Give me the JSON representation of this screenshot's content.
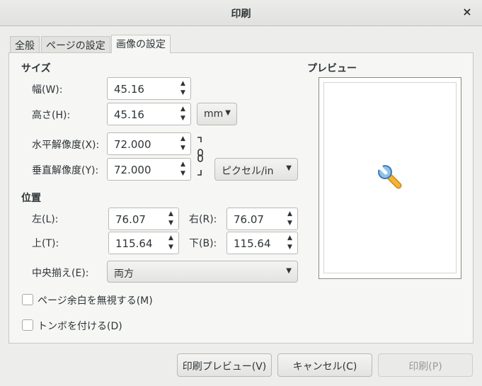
{
  "window": {
    "title": "印刷",
    "close": "×"
  },
  "tabs": [
    {
      "label": "全般"
    },
    {
      "label": "ページの設定"
    },
    {
      "label": "画像の設定",
      "active": true
    }
  ],
  "size": {
    "heading": "サイズ",
    "width_label": "幅(W):",
    "width_value": "45.16",
    "height_label": "高さ(H):",
    "height_value": "45.16",
    "unit": "mm",
    "xres_label": "水平解像度(X):",
    "xres_value": "72.000",
    "yres_label": "垂直解像度(Y):",
    "yres_value": "72.000",
    "res_unit": "ピクセル/in"
  },
  "position": {
    "heading": "位置",
    "left_label": "左(L):",
    "left_value": "76.07",
    "right_label": "右(R):",
    "right_value": "76.07",
    "top_label": "上(T):",
    "top_value": "115.64",
    "bottom_label": "下(B):",
    "bottom_value": "115.64",
    "center_label": "中央揃え(E):",
    "center_value": "両方"
  },
  "options": {
    "ignore_margins": "ページ余白を無視する(M)",
    "crop_marks": "トンボを付ける(D)"
  },
  "preview": {
    "heading": "プレビュー",
    "icon": "wrench-icon"
  },
  "buttons": {
    "print_preview": "印刷プレビュー(V)",
    "cancel": "キャンセル(C)",
    "print": "印刷(P)"
  },
  "icons": {
    "up": "▲",
    "down": "▼",
    "caret": "▼"
  }
}
